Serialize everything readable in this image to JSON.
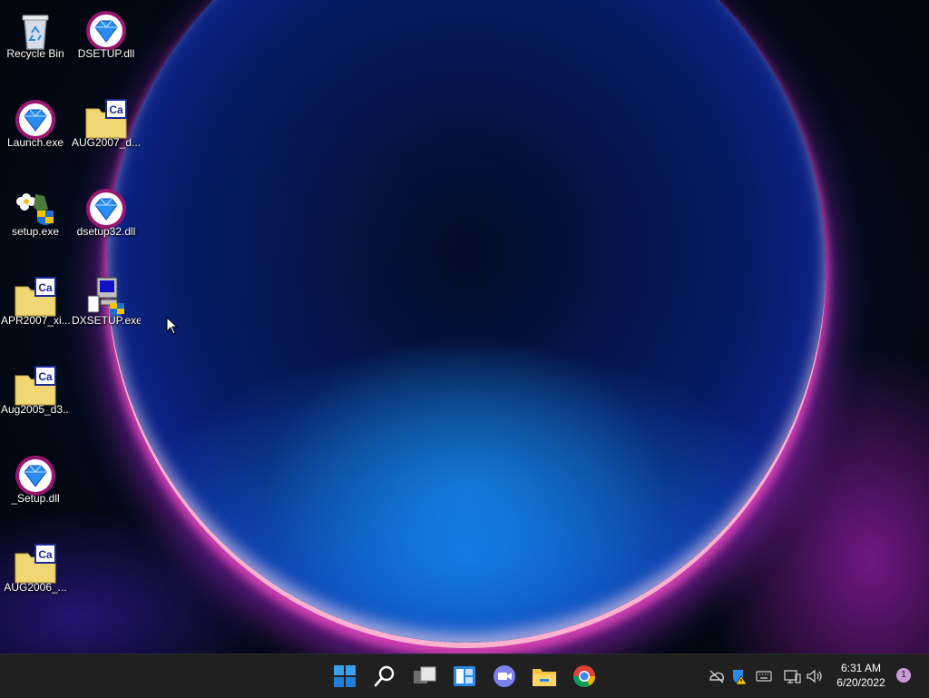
{
  "desktop": {
    "icons": [
      {
        "label": "Recycle Bin",
        "icon": "recycle-bin-icon"
      },
      {
        "label": "DSETUP.dll",
        "icon": "diamond-installer-icon"
      },
      {
        "label": "Launch.exe",
        "icon": "diamond-installer-icon"
      },
      {
        "label": "AUG2007_d...",
        "icon": "cab-folder-icon"
      },
      {
        "label": "setup.exe",
        "icon": "setup-flower-shield-icon"
      },
      {
        "label": "dsetup32.dll",
        "icon": "diamond-installer-icon"
      },
      {
        "label": "APR2007_xi...",
        "icon": "cab-folder-icon"
      },
      {
        "label": "DXSETUP.exe",
        "icon": "dxsetup-computer-icon"
      },
      {
        "label": "Aug2005_d3...",
        "icon": "cab-folder-icon"
      },
      {
        "label": "_Setup.dll",
        "icon": "diamond-installer-icon"
      },
      {
        "label": "AUG2006_...",
        "icon": "cab-folder-icon"
      }
    ]
  },
  "taskbar": {
    "pinned": [
      "start-icon",
      "search-icon",
      "task-view-icon",
      "widgets-icon",
      "teams-chat-icon",
      "file-explorer-icon",
      "chrome-icon"
    ],
    "tray": [
      "onedrive-offline-icon",
      "security-warning-icon",
      "keyboard-icon",
      "network-icon",
      "volume-icon"
    ],
    "time": "6:31 AM",
    "date": "6/20/2022",
    "notification_count": "1"
  },
  "colors": {
    "taskbar": "#202020",
    "accent": "#0078d4",
    "wallpaper_dark": "#02060f",
    "badge": "#c89ad6"
  }
}
